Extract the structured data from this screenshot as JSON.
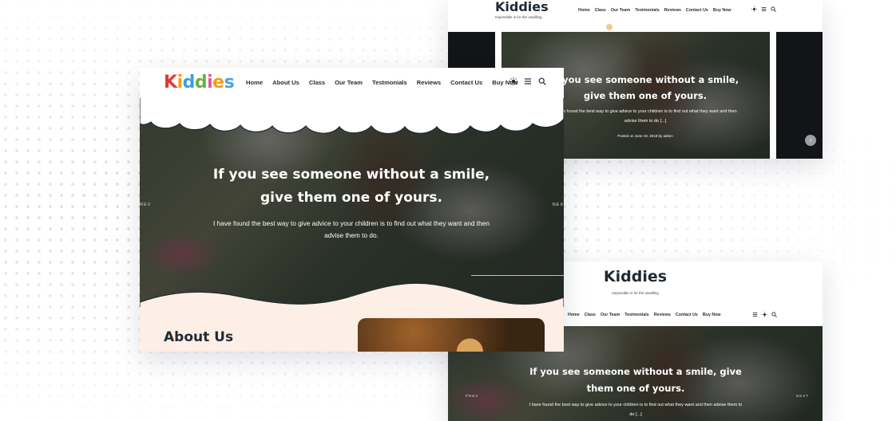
{
  "brand": {
    "name": "Kiddies",
    "tagline": "Impossible is for the unwilling",
    "letter_colors": [
      "#e53935",
      "#f39c12",
      "#3c9ee5",
      "#6ab04c",
      "#e056a0",
      "#f39c12",
      "#4aa3df"
    ],
    "accent": "#f7c891",
    "cream": "#fdeee6",
    "dark": "#1e2a33"
  },
  "nav": {
    "items": [
      "Home",
      "About Us",
      "Class",
      "Our Team",
      "Testmonials",
      "Reviews",
      "Contact Us",
      "Buy Now"
    ],
    "items_short": [
      "Home",
      "Class",
      "Our Team",
      "Testmonials",
      "Reviews",
      "Contact Us",
      "Buy Now"
    ]
  },
  "icons": [
    "sun-icon",
    "menu-icon",
    "search-icon"
  ],
  "hero": {
    "title": "If you see someone without a smile, give them one of yours.",
    "subtitle": "I have found the best way to give advice to your children is to find out what they want and then advise them to do.",
    "subtitle_short": "I have found the best way to give advice to your children is to find out what they want and then advise them to do [...]",
    "posted": "Posted on June 19, 2018 by admin",
    "prev_label": "REV",
    "next_label": "NEX",
    "prev_label_small": "PREV",
    "next_label_small": "NEXT"
  },
  "about": {
    "title": "About Us"
  }
}
